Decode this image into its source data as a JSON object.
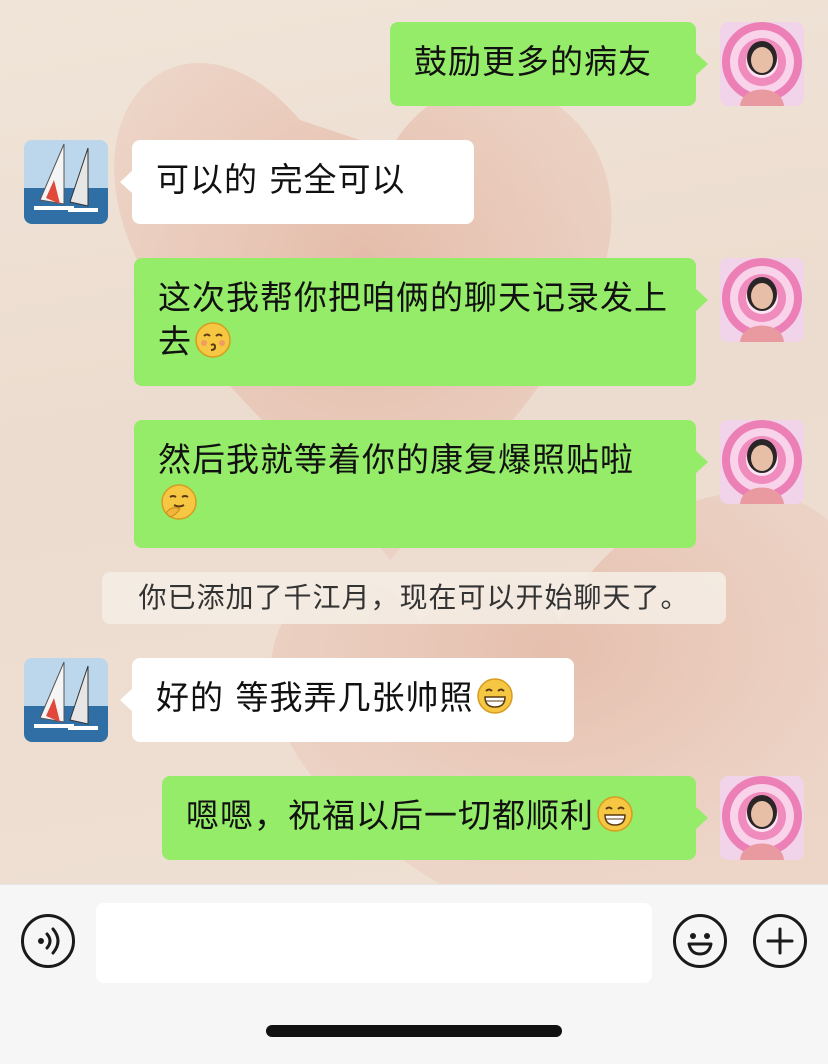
{
  "messages": [
    {
      "side": "right",
      "text": "鼓励更多的病友"
    },
    {
      "side": "left",
      "text": "可以的  完全可以"
    },
    {
      "side": "right",
      "text": "这次我帮你把咱俩的聊天记录发上去",
      "emoji": "kissing-face-emoji"
    },
    {
      "side": "right",
      "text": "然后我就等着你的康复爆照贴啦",
      "emoji": "thinking-hand-face-emoji"
    },
    {
      "side": "left",
      "text": "好的  等我弄几张帅照",
      "emoji": "grinning-face-emoji"
    },
    {
      "side": "right",
      "text": "嗯嗯，祝福以后一切都顺利",
      "emoji": "grinning-face-emoji"
    }
  ],
  "system_message": "你已添加了千江月，现在可以开始聊天了。",
  "input": {
    "value": "",
    "placeholder": ""
  },
  "icons": {
    "voice": "voice-icon",
    "emoji": "smiley-icon",
    "more": "plus-icon"
  },
  "colors": {
    "sent_bubble": "#95ec69",
    "received_bubble": "#ffffff",
    "bottom_bar": "#f6f6f6"
  }
}
